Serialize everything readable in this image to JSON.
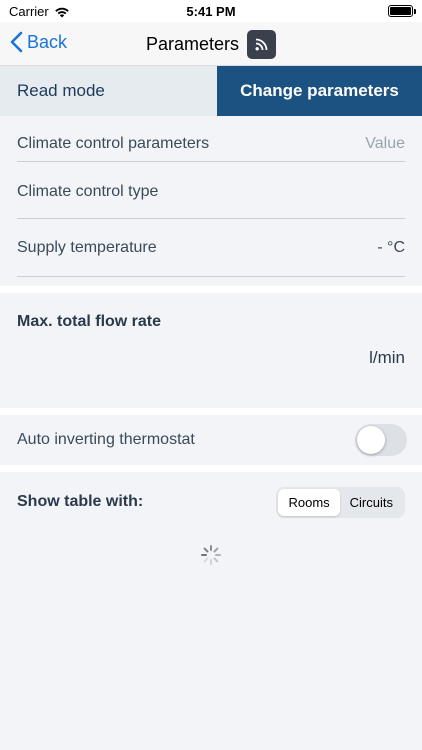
{
  "status_bar": {
    "carrier": "Carrier",
    "time": "5:41 PM",
    "wifi_icon": "wifi-icon",
    "battery_level": 1.0
  },
  "nav": {
    "back_label": "Back",
    "title": "Parameters",
    "rss_icon": "rss-icon",
    "accent": "#1a73d9"
  },
  "tabs": {
    "read_label": "Read mode",
    "change_label": "Change parameters",
    "active": "change",
    "active_color": "#1b5281"
  },
  "climate": {
    "header_label": "Climate control parameters",
    "header_value": "Value",
    "type_label": "Climate control type",
    "type_value": "",
    "supply_label": "Supply temperature",
    "supply_value": "- °C"
  },
  "flow": {
    "label": "Max. total flow rate",
    "unit": "l/min"
  },
  "thermostat": {
    "label": "Auto inverting thermostat",
    "enabled": false
  },
  "table_with": {
    "label": "Show table with:",
    "options": [
      "Rooms",
      "Circuits"
    ],
    "selected": "Rooms"
  },
  "loading": {
    "spinner_icon": "loading-spinner-icon"
  }
}
